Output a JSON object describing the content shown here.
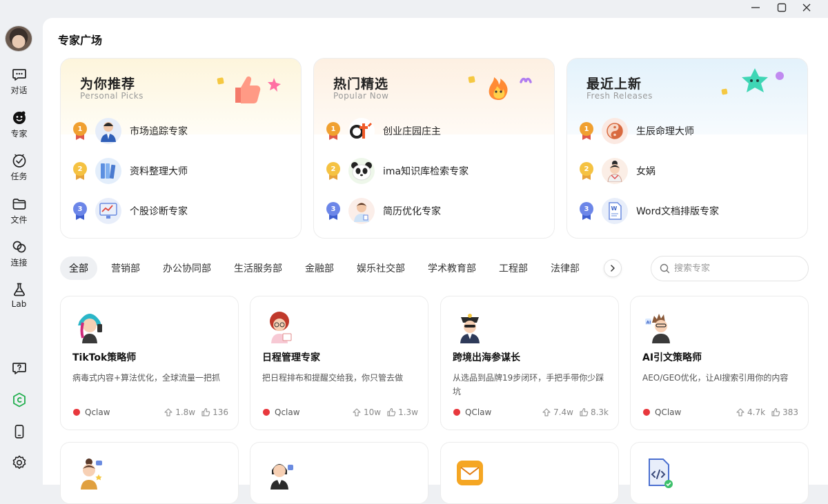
{
  "page": {
    "title": "专家广场"
  },
  "nav": {
    "items": [
      {
        "label": "对话",
        "icon": "chat-icon"
      },
      {
        "label": "专家",
        "icon": "expert-icon"
      },
      {
        "label": "任务",
        "icon": "task-icon"
      },
      {
        "label": "文件",
        "icon": "folder-icon"
      },
      {
        "label": "连接",
        "icon": "link-icon"
      },
      {
        "label": "Lab",
        "icon": "flask-icon"
      }
    ],
    "bottom_icons": [
      "help-icon",
      "qclaw-icon",
      "phone-icon",
      "settings-icon"
    ]
  },
  "recommend": [
    {
      "title": "为你推荐",
      "subtitle": "Personal Picks",
      "accent": "#fdf7df",
      "items": [
        {
          "rank": "1",
          "name": "市场追踪专家"
        },
        {
          "rank": "2",
          "name": "资料整理大师"
        },
        {
          "rank": "3",
          "name": "个股诊断专家"
        }
      ]
    },
    {
      "title": "热门精选",
      "subtitle": "Popular Now",
      "accent": "#fdf1e6",
      "items": [
        {
          "rank": "1",
          "name": "创业庄园庄主"
        },
        {
          "rank": "2",
          "name": "ima知识库检索专家"
        },
        {
          "rank": "3",
          "name": "简历优化专家"
        }
      ]
    },
    {
      "title": "最近上新",
      "subtitle": "Fresh Releases",
      "accent": "#e6f3fb",
      "items": [
        {
          "rank": "1",
          "name": "生辰命理大师"
        },
        {
          "rank": "2",
          "name": "女娲"
        },
        {
          "rank": "3",
          "name": "Word文档排版专家"
        }
      ]
    }
  ],
  "tabs": [
    "全部",
    "营销部",
    "办公协同部",
    "生活服务部",
    "金融部",
    "娱乐社交部",
    "学术教育部",
    "工程部",
    "法律部"
  ],
  "active_tab": "全部",
  "search": {
    "placeholder": "搜索专家"
  },
  "cards": [
    {
      "name": "TikTok策略师",
      "desc": "病毒式内容+算法优化，全球流量一把抓",
      "author": "Qclaw",
      "views": "1.8w",
      "likes": "136"
    },
    {
      "name": "日程管理专家",
      "desc": "把日程排布和提醒交给我，你只管去做",
      "author": "Qclaw",
      "views": "10w",
      "likes": "1.3w"
    },
    {
      "name": "跨境出海参谋长",
      "desc": "从选品到品牌19步闭环，手把手带你少踩坑",
      "author": "QClaw",
      "views": "7.4w",
      "likes": "8.3k"
    },
    {
      "name": "AI引文策略师",
      "desc": "AEO/GEO优化，让AI搜索引用你的内容",
      "author": "QClaw",
      "views": "4.7k",
      "likes": "383"
    }
  ]
}
